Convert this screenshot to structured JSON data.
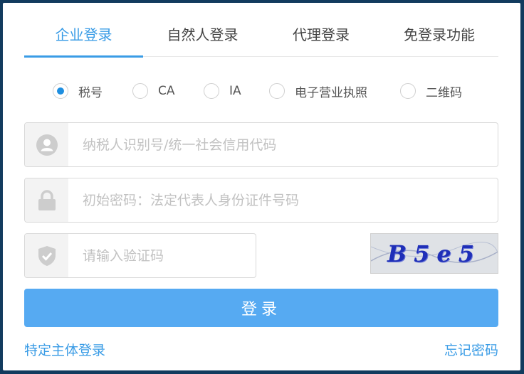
{
  "tabs": [
    {
      "label": "企业登录",
      "active": true
    },
    {
      "label": "自然人登录",
      "active": false
    },
    {
      "label": "代理登录",
      "active": false
    },
    {
      "label": "免登录功能",
      "active": false
    }
  ],
  "login_type": {
    "options": [
      "税号",
      "CA",
      "IA",
      "电子营业执照",
      "二维码"
    ],
    "selected": "税号"
  },
  "fields": {
    "taxpayer_id": {
      "placeholder": "纳税人识别号/统一社会信用代码",
      "value": ""
    },
    "password": {
      "placeholder": "初始密码：法定代表人身份证件号码",
      "value": ""
    },
    "captcha": {
      "placeholder": "请输入验证码",
      "value": ""
    }
  },
  "captcha_image": {
    "text": "B5e5"
  },
  "login_button": {
    "label": "登录"
  },
  "links": {
    "special_login": "特定主体登录",
    "forgot_password": "忘记密码"
  },
  "colors": {
    "accent": "#3a9ce6",
    "button": "#56aaf2",
    "radio_checked": "#1f8fe0",
    "background": "#123b5e"
  },
  "icons": {
    "taxpayer_id": "user-icon",
    "password": "lock-icon",
    "captcha": "shield-check-icon"
  }
}
